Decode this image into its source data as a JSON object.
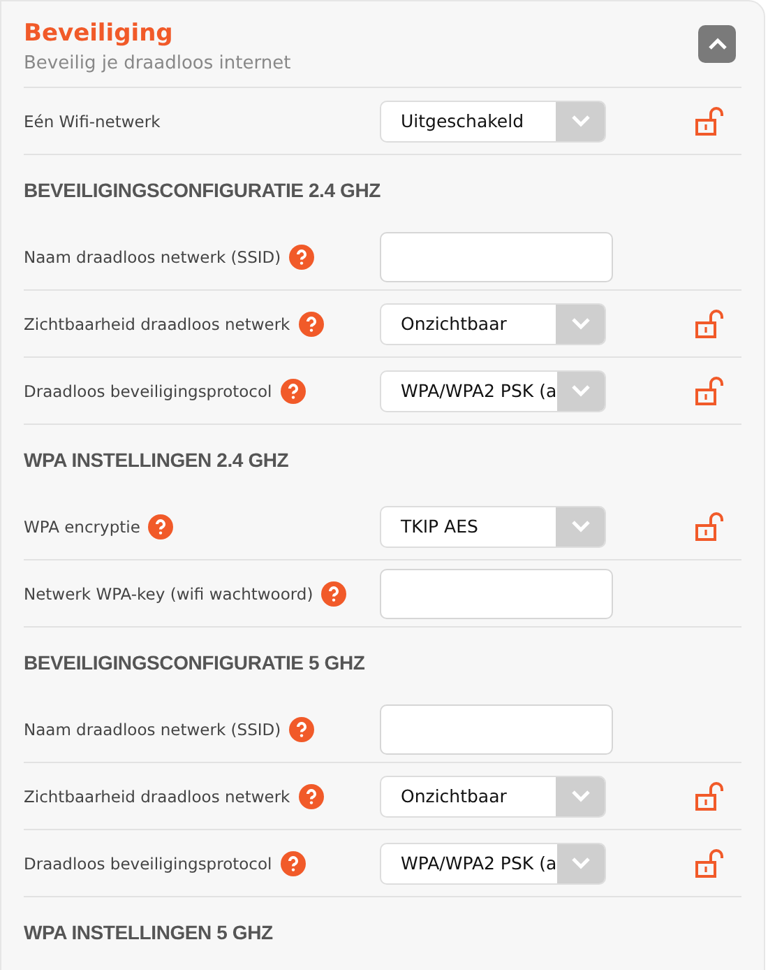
{
  "header": {
    "title": "Beveiliging",
    "subtitle": "Beveilig je draadloos internet"
  },
  "rows": [
    {
      "kind": "select",
      "label": "Eén Wifi-netwerk",
      "help": false,
      "value": "Uitgeschakeld"
    },
    {
      "kind": "heading",
      "label": "BEVEILIGINGSCONFIGURATIE 2.4 GHZ"
    },
    {
      "kind": "input",
      "label": "Naam draadloos netwerk (SSID)",
      "help": true
    },
    {
      "kind": "select",
      "label": "Zichtbaarheid draadloos netwerk",
      "help": true,
      "value": "Onzichtbaar"
    },
    {
      "kind": "select",
      "label": "Draadloos beveiligingsprotocol",
      "help": true,
      "value": "WPA/WPA2 PSK (a"
    },
    {
      "kind": "heading",
      "label": "WPA INSTELLINGEN 2.4 GHZ"
    },
    {
      "kind": "select",
      "label": "WPA encryptie",
      "help": true,
      "value": "TKIP AES"
    },
    {
      "kind": "input",
      "label": "Netwerk WPA-key (wifi wachtwoord)",
      "help": true
    },
    {
      "kind": "heading",
      "label": "BEVEILIGINGSCONFIGURATIE 5 GHZ"
    },
    {
      "kind": "input",
      "label": "Naam draadloos netwerk (SSID)",
      "help": true
    },
    {
      "kind": "select",
      "label": "Zichtbaarheid draadloos netwerk",
      "help": true,
      "value": "Onzichtbaar"
    },
    {
      "kind": "select",
      "label": "Draadloos beveiligingsprotocol",
      "help": true,
      "value": "WPA/WPA2 PSK (a"
    },
    {
      "kind": "heading",
      "label": "WPA INSTELLINGEN 5 GHZ"
    }
  ]
}
